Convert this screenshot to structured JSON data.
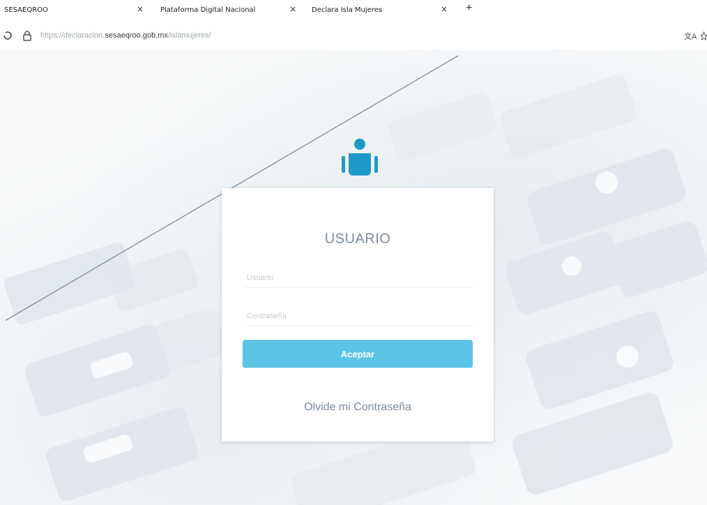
{
  "browser": {
    "tabs": [
      {
        "label": "SESAEQROO"
      },
      {
        "label": "Plataforma Digital Nacional"
      },
      {
        "label": "Declara Isla Mujeres"
      }
    ],
    "tab_close_glyph": "×",
    "new_tab_glyph": "+",
    "url": {
      "scheme": "https://",
      "subdomain": "declaracion.",
      "domain": "sesaeqroo.gob.mx",
      "path": "/islamujeres/"
    },
    "translate_glyph": "文A"
  },
  "login": {
    "title": "USUARIO",
    "username_placeholder": "Usuario",
    "password_placeholder": "Contraseña",
    "submit_label": "Aceptar",
    "forgot_label": "Olvide mi Contraseña"
  },
  "colors": {
    "accent": "#5bc4e6",
    "avatar": "#1e9ac9",
    "title_text": "#7b8a98"
  }
}
